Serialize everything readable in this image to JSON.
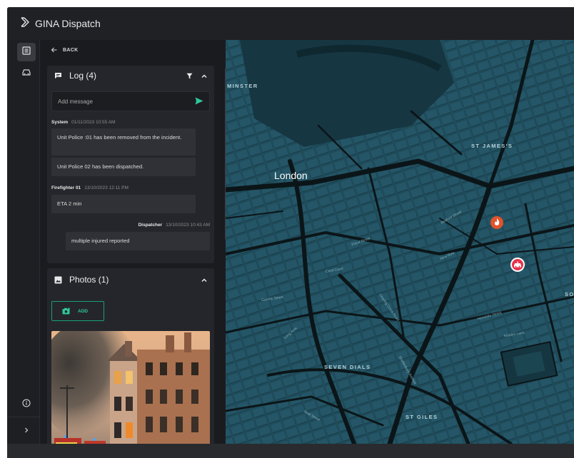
{
  "app": {
    "title": "GINA Dispatch"
  },
  "rail": {
    "icons": [
      "list-icon",
      "car-icon",
      "info-icon",
      "chevron-right-icon"
    ]
  },
  "panel": {
    "back_label": "BACK",
    "log": {
      "title": "Log (4)",
      "input_placeholder": "Add message",
      "entries": [
        {
          "sender": "System",
          "timestamp": "01/11/2023 10:55 AM",
          "messages": [
            "Unit Police :01  has been removed from the incident.",
            "Unit Police 02 has been dispatched."
          ]
        },
        {
          "sender": "Firefighter 01",
          "timestamp": "13/10/2023 12:11 PM",
          "messages": [
            "ETA 2 min"
          ]
        },
        {
          "sender": "Dispatcher",
          "timestamp": "13/10/2023 10:43 AM",
          "messages": [
            "multiple injured reported"
          ]
        }
      ]
    },
    "photos": {
      "title": "Photos (1)",
      "add_label": "ADD"
    }
  },
  "map": {
    "city_label": "London",
    "district_labels": [
      "MINSTER",
      "ST JAMES'S",
      "SEVEN DIALS",
      "ST GILES",
      "SO"
    ],
    "street_labels": [
      "Cecil Court",
      "Long Acre",
      "Garrick Street",
      "Floral Street",
      "Neal Street",
      "Charing Cross Road",
      "New Row",
      "Shaftesbury Avenue",
      "Bedford Street",
      "Henrietta Street",
      "Maiden Lane"
    ],
    "markers": [
      "fire-marker-icon",
      "police-marker-icon"
    ],
    "colors": {
      "land": "#1f4b5a",
      "road": "#0b1518",
      "water": "#163642",
      "fire": "#e0532b",
      "police": "#e8324a"
    }
  },
  "colors": {
    "accent": "#2fc79a",
    "panel": "#25262b",
    "background": "#1c1d21"
  }
}
